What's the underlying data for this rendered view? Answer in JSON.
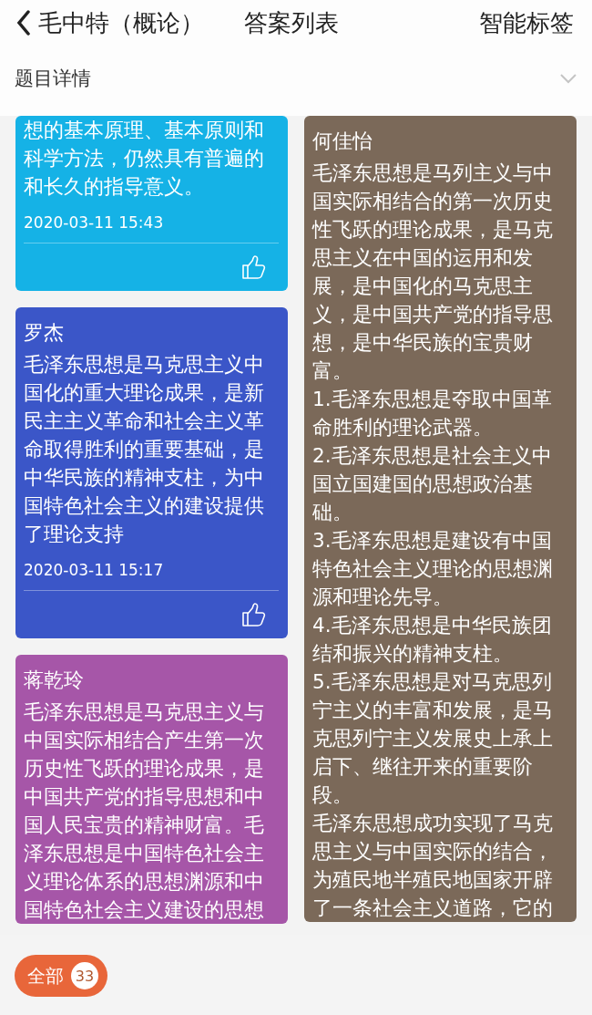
{
  "nav": {
    "title": "毛中特（概论）",
    "center": "答案列表",
    "right": "智能标签"
  },
  "detail_bar": {
    "label": "题目详情",
    "expanded": false
  },
  "columns": [
    {
      "cards": [
        {
          "color": "#15b2e6",
          "paragraphs": [
            "想的基本原理、基本原则和科学方法，仍然具有普遍的和长久的指导意义。"
          ],
          "time": "2020-03-11 15:43"
        },
        {
          "color": "#3b56c8",
          "name": "罗杰",
          "paragraphs": [
            "毛泽东思想是马克思主义中国化的重大理论成果，是新民主主义革命和社会主义革命取得胜利的重要基础，是中华民族的精神支柱，为中国特色社会主义的建设提供了理论支持"
          ],
          "time": "2020-03-11 15:17"
        },
        {
          "color": "#a656a8",
          "name": "蒋乾玲",
          "paragraphs": [
            "毛泽东思想是马克思主义与中国实际相结合产生第一次历史性飞跃的理论成果，是中国共产党的指导思想和中国人民宝贵的精神财富。毛泽东思想是中国特色社会主义理论体系的思想渊源和中国特色社会主义建设的思想"
          ]
        }
      ]
    },
    {
      "cards": [
        {
          "color": "#7b6959",
          "name": "何佳怡",
          "paragraphs": [
            "毛泽东思想是马列主义与中国实际相结合的第一次历史性飞跃的理论成果，是马克思主义在中国的运用和发展，是中国化的马克思主义，是中国共产党的指导思想，是中华民族的宝贵财富。",
            "1.毛泽东思想是夺取中国革命胜利的理论武器。",
            "2.毛泽东思想是社会主义中国立国建国的思想政治基础。",
            "3.毛泽东思想是建设有中国特色社会主义理论的思想渊源和理论先导。",
            "4.毛泽东思想是中华民族团结和振兴的精神支柱。",
            "5.毛泽东思想是对马克思列宁主义的丰富和发展，是马克思列宁主义发展史上承上启下、继往开来的重要阶段。",
            "毛泽东思想成功实现了马克思主义与中国实际的结合，为殖民地半殖民地国家开辟了一条社会主义道路，它的"
          ]
        }
      ]
    }
  ],
  "footer": {
    "filter": {
      "label": "全部",
      "count": "33",
      "selected": true
    }
  }
}
